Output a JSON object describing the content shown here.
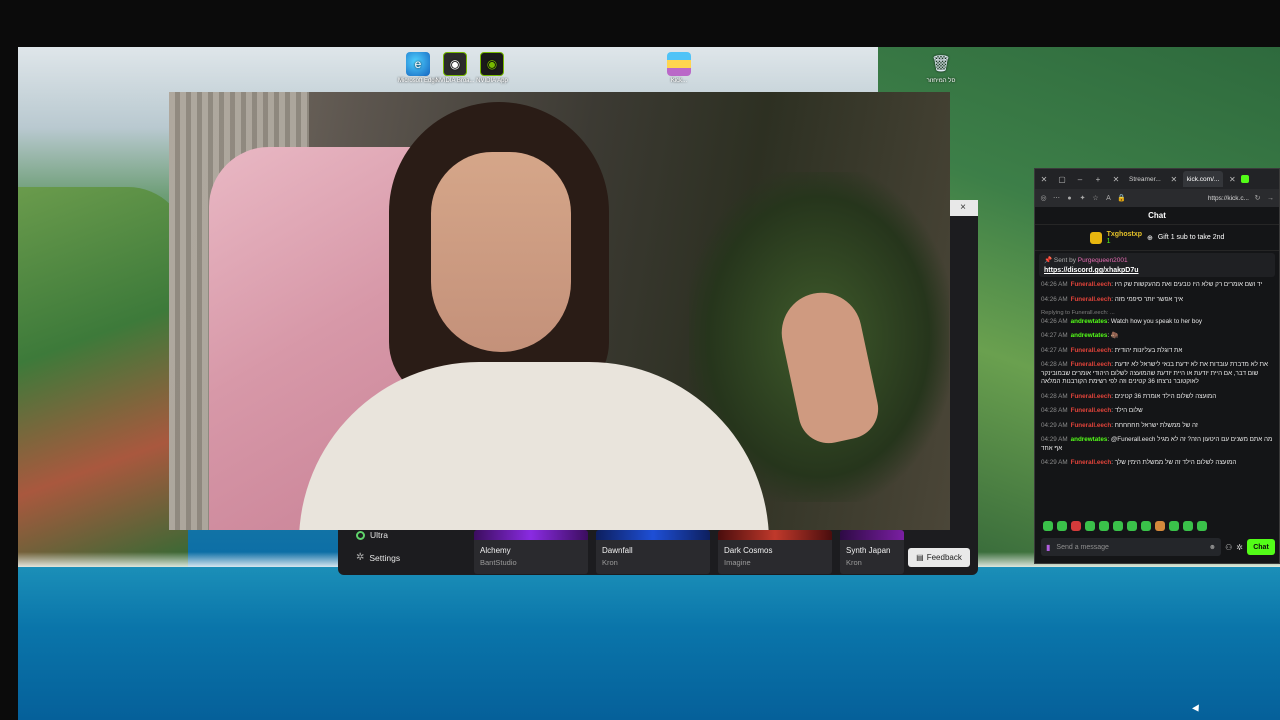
{
  "desktop": {
    "icons": [
      {
        "icon": "edge-icon",
        "label": "Microsoft Edge"
      },
      {
        "icon": "nvidia-broadcast-icon",
        "label": "NVIDIA Broa..."
      },
      {
        "icon": "nvidia-app-icon",
        "label": "NVIDIA App"
      },
      {
        "icon": "kick-app-icon",
        "label": "Kick..."
      },
      {
        "icon": "recycle-bin-icon",
        "label": "סל המיחזור"
      }
    ]
  },
  "music_app": {
    "close_glyph": "×",
    "sidebar": [
      {
        "icon": "ring-icon",
        "label": "Ultra"
      },
      {
        "icon": "gear-icon",
        "label": "Settings"
      }
    ],
    "tracks": [
      {
        "name": "Alchemy",
        "artist": "BantStudio",
        "accent": "#8a2be2"
      },
      {
        "name": "Dawnfall",
        "artist": "Kron",
        "accent": "#1e4fd6"
      },
      {
        "name": "Dark Cosmos",
        "artist": "Imagine",
        "accent": "#c0392b"
      },
      {
        "name": "Synth Japan",
        "artist": "Kron",
        "accent": "#7a1fa2"
      }
    ],
    "feedback_label": "Feedback"
  },
  "chat_window": {
    "tabs": [
      {
        "label": "Streamer...",
        "active": false
      },
      {
        "label": "kick.com/...",
        "active": true
      }
    ],
    "url": "https://kick.c...",
    "title": "Chat",
    "gift": {
      "gifter": "Txghostxp",
      "count": "1",
      "text": "Gift 1 sub to take 2nd"
    },
    "pinned": {
      "sent_by_label": "Sent by",
      "user": "Purgequeen2001",
      "link": "https://discord.gg/xhakpD7u"
    },
    "messages": [
      {
        "time": "04:26 AM",
        "user": "Funerall.eech",
        "user_color": "red",
        "text": "יד ושם אומרים רק שלא היו טבעים ואת מהעקשות שק היו",
        "reply": ""
      },
      {
        "time": "04:26 AM",
        "user": "Funerall.eech",
        "user_color": "red",
        "text": "איך אפשר יותר סיפמי מזה",
        "reply": ""
      },
      {
        "time": "04:26 AM",
        "user": "andrewtates",
        "user_color": "green",
        "text": "Watch how you speak to her boy",
        "reply": "Replying to Funerall.eech: ..."
      },
      {
        "time": "04:27 AM",
        "user": "andrewtates",
        "user_color": "green",
        "text": "",
        "reply": ""
      },
      {
        "time": "04:27 AM",
        "user": "Funerall.eech",
        "user_color": "red",
        "text": "את דוגלת בעליונות יהודית",
        "reply": ""
      },
      {
        "time": "04:28 AM",
        "user": "Funerall.eech",
        "user_color": "red",
        "text": "את לא מדברת עובדות את לא ידעת בנאי לישראל לא יודעת שום דבר, אם היית יודעת או היית יודעת שהמועצה לשלום היהודי אומרים שבמובינקר לאוקטובר נרצחו 36 קטינים וזה לפי רשימת הקורבנות המלאה",
        "reply": ""
      },
      {
        "time": "04:28 AM",
        "user": "Funerall.eech",
        "user_color": "red",
        "text": "המועצה לשלום הילד אומרת 36 קטינים",
        "reply": ""
      },
      {
        "time": "04:28 AM",
        "user": "Funerall.eech",
        "user_color": "red",
        "text": "שלום הילד",
        "reply": ""
      },
      {
        "time": "04:29 AM",
        "user": "Funerall.eech",
        "user_color": "red",
        "text": "זה של ממשלת ישראל חחחחחח",
        "reply": ""
      },
      {
        "time": "04:29 AM",
        "user": "andrewtates",
        "user_color": "green",
        "text": "@Funerall.eech מה אתם משנים עם היטעון הזה? זה לא מגיל אף אחד",
        "reply": ""
      },
      {
        "time": "04:29 AM",
        "user": "Funerall.eech",
        "user_color": "red",
        "text": "המועצה לשלום הילד זה של ממשלת הימין שלך",
        "reply": ""
      }
    ],
    "input_placeholder": "Send a message",
    "send_label": "Chat"
  }
}
